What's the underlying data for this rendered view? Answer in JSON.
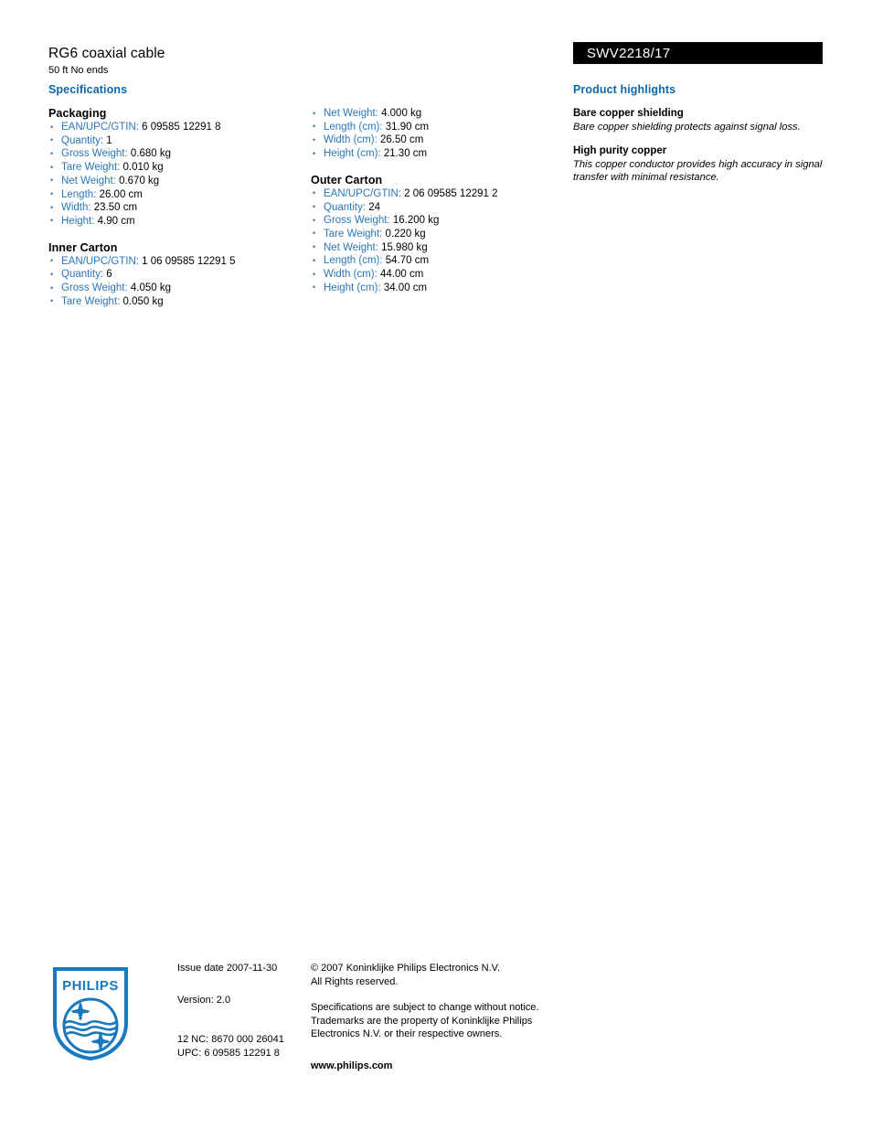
{
  "header": {
    "product_title": "RG6 coaxial cable",
    "product_subtitle": "50 ft No ends",
    "model_number": "SWV2218/17"
  },
  "sections": {
    "specifications_heading": "Specifications",
    "highlights_heading": "Product highlights"
  },
  "specifications": {
    "packaging": {
      "title": "Packaging",
      "items": [
        {
          "label": "EAN/UPC/GTIN:",
          "value": "6 09585 12291 8"
        },
        {
          "label": "Quantity:",
          "value": "1"
        },
        {
          "label": "Gross Weight:",
          "value": "0.680 kg"
        },
        {
          "label": "Tare Weight:",
          "value": "0.010 kg"
        },
        {
          "label": "Net Weight:",
          "value": "0.670 kg"
        },
        {
          "label": "Length:",
          "value": "26.00 cm"
        },
        {
          "label": "Width:",
          "value": "23.50 cm"
        },
        {
          "label": "Height:",
          "value": "4.90 cm"
        }
      ]
    },
    "inner_carton": {
      "title": "Inner Carton",
      "items_left": [
        {
          "label": "EAN/UPC/GTIN:",
          "value": "1 06 09585 12291 5"
        },
        {
          "label": "Quantity:",
          "value": "6"
        },
        {
          "label": "Gross Weight:",
          "value": "4.050 kg"
        },
        {
          "label": "Tare Weight:",
          "value": "0.050 kg"
        }
      ],
      "items_right": [
        {
          "label": "Net Weight:",
          "value": "4.000 kg"
        },
        {
          "label": "Length (cm):",
          "value": "31.90 cm"
        },
        {
          "label": "Width (cm):",
          "value": "26.50 cm"
        },
        {
          "label": "Height (cm):",
          "value": "21.30 cm"
        }
      ]
    },
    "outer_carton": {
      "title": "Outer Carton",
      "items": [
        {
          "label": "EAN/UPC/GTIN:",
          "value": "2 06 09585 12291 2"
        },
        {
          "label": "Quantity:",
          "value": "24"
        },
        {
          "label": "Gross Weight:",
          "value": "16.200 kg"
        },
        {
          "label": "Tare Weight:",
          "value": "0.220 kg"
        },
        {
          "label": "Net Weight:",
          "value": "15.980 kg"
        },
        {
          "label": "Length (cm):",
          "value": "54.70 cm"
        },
        {
          "label": "Width (cm):",
          "value": "44.00 cm"
        },
        {
          "label": "Height (cm):",
          "value": "34.00 cm"
        }
      ]
    }
  },
  "highlights": [
    {
      "title": "Bare copper shielding",
      "description": "Bare copper shielding protects against signal loss."
    },
    {
      "title": "High purity copper",
      "description": "This copper conductor provides high accuracy in signal transfer with minimal resistance."
    }
  ],
  "footer": {
    "logo_wordmark": "PHILIPS",
    "issue_date": "Issue date 2007-11-30",
    "version": "Version: 2.0",
    "nc_code": "12 NC: 8670 000 26041",
    "upc": "UPC: 6 09585 12291 8",
    "copyright_line1": "© 2007 Koninklijke Philips Electronics N.V.",
    "copyright_line2": "All Rights reserved.",
    "disclaimer": "Specifications are subject to change without notice. Trademarks are the property of Koninklijke Philips Electronics N.V. or their respective owners.",
    "website": "www.philips.com"
  },
  "colors": {
    "heading_blue": "#0d68ab",
    "label_blue": "#2a76b8",
    "model_bar_bg": "#000000",
    "logo_blue": "#1879bf"
  }
}
